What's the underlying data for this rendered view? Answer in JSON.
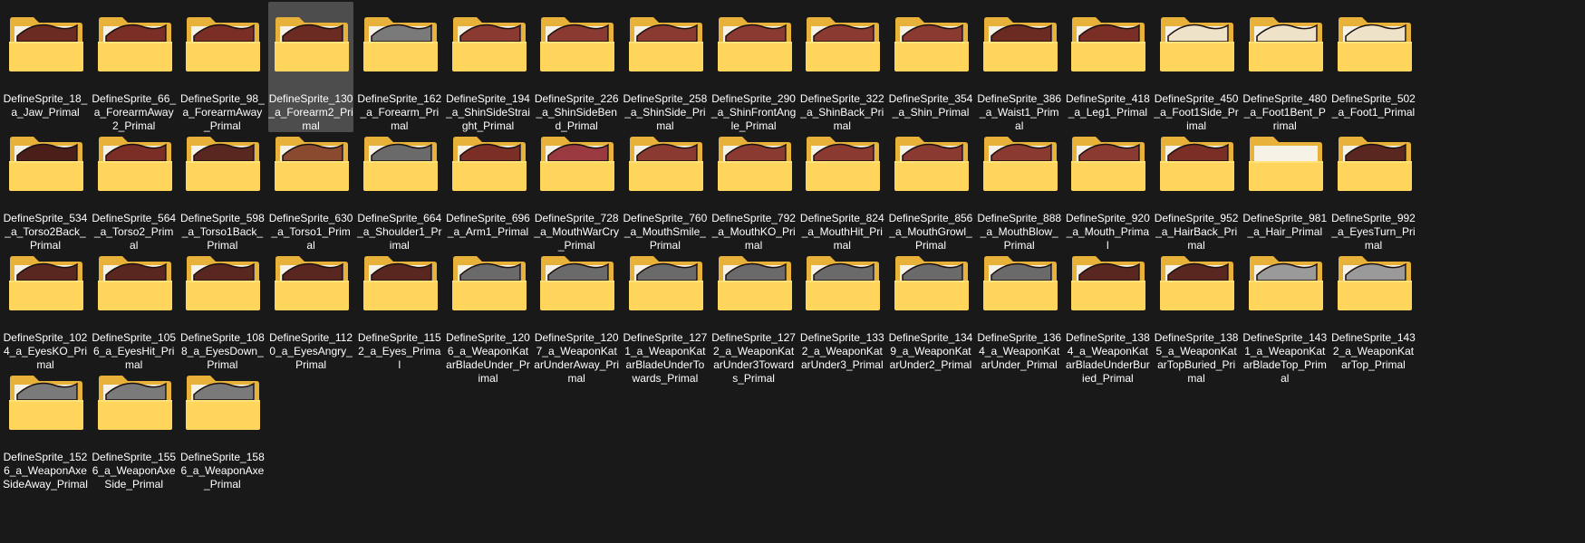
{
  "colors": {
    "background": "#191919",
    "selected": "#4d4d4d",
    "text": "#ffffff",
    "folder_back": "#e8b23a",
    "folder_front": "#ffd55c"
  },
  "icon_name": "folder-icon",
  "selected_index": 3,
  "items": [
    {
      "label": "DefineSprite_18_a_Jaw_Primal",
      "art": "#6b2a22"
    },
    {
      "label": "DefineSprite_66_a_ForearmAway2_Primal",
      "art": "#7a2e26"
    },
    {
      "label": "DefineSprite_98_a_ForearmAway_Primal",
      "art": "#7a2e26"
    },
    {
      "label": "DefineSprite_130_a_Forearm2_Primal",
      "art": "#6b2a22"
    },
    {
      "label": "DefineSprite_162_a_Forearm_Primal",
      "art": "#7a7a7a"
    },
    {
      "label": "DefineSprite_194_a_ShinSideStraight_Primal",
      "art": "#8a3a30"
    },
    {
      "label": "DefineSprite_226_a_ShinSideBend_Primal",
      "art": "#8a3a30"
    },
    {
      "label": "DefineSprite_258_a_ShinSide_Primal",
      "art": "#8a3a30"
    },
    {
      "label": "DefineSprite_290_a_ShinFrontAngle_Primal",
      "art": "#8a3a30"
    },
    {
      "label": "DefineSprite_322_a_ShinBack_Primal",
      "art": "#8a3a30"
    },
    {
      "label": "DefineSprite_354_a_Shin_Primal",
      "art": "#8a3a30"
    },
    {
      "label": "DefineSprite_386_a_Waist1_Primal",
      "art": "#6b2a22"
    },
    {
      "label": "DefineSprite_418_a_Leg1_Primal",
      "art": "#7a2e26"
    },
    {
      "label": "DefineSprite_450_a_Foot1Side_Primal",
      "art": "#eee3c8"
    },
    {
      "label": "DefineSprite_480_a_Foot1Bent_Primal",
      "art": "#eee3c8"
    },
    {
      "label": "DefineSprite_502_a_Foot1_Primal",
      "art": "#eee3c8"
    },
    {
      "label": "DefineSprite_534_a_Torso2Back_Primal",
      "art": "#4a1f1a"
    },
    {
      "label": "DefineSprite_564_a_Torso2_Primal",
      "art": "#7a2e26"
    },
    {
      "label": "DefineSprite_598_a_Torso1Back_Primal",
      "art": "#5a2720"
    },
    {
      "label": "DefineSprite_630_a_Torso1_Primal",
      "art": "#8a4a30"
    },
    {
      "label": "DefineSprite_664_a_Shoulder1_Primal",
      "art": "#6a6a6a"
    },
    {
      "label": "DefineSprite_696_a_Arm1_Primal",
      "art": "#7a2e26"
    },
    {
      "label": "DefineSprite_728_a_MouthWarCry_Primal",
      "art": "#9a3a40"
    },
    {
      "label": "DefineSprite_760_a_MouthSmile_Primal",
      "art": "#8a3a30"
    },
    {
      "label": "DefineSprite_792_a_MouthKO_Primal",
      "art": "#8a3a30"
    },
    {
      "label": "DefineSprite_824_a_MouthHit_Primal",
      "art": "#8a3a30"
    },
    {
      "label": "DefineSprite_856_a_MouthGrowl_Primal",
      "art": "#8a3a30"
    },
    {
      "label": "DefineSprite_888_a_MouthBlow_Primal",
      "art": "#8a3a30"
    },
    {
      "label": "DefineSprite_920_a_Mouth_Primal",
      "art": "#8a3a30"
    },
    {
      "label": "DefineSprite_952_a_HairBack_Primal",
      "art": "#7a2e26"
    },
    {
      "label": "DefineSprite_981_a_Hair_Primal",
      "art": ""
    },
    {
      "label": "DefineSprite_992_a_EyesTurn_Primal",
      "art": "#5a2720"
    },
    {
      "label": "DefineSprite_1024_a_EyesKO_Primal",
      "art": "#5a2720"
    },
    {
      "label": "DefineSprite_1056_a_EyesHit_Primal",
      "art": "#5a2720"
    },
    {
      "label": "DefineSprite_1088_a_EyesDown_Primal",
      "art": "#5a2720"
    },
    {
      "label": "DefineSprite_1120_a_EyesAngry_Primal",
      "art": "#5a2720"
    },
    {
      "label": "DefineSprite_1152_a_Eyes_Primal",
      "art": "#5a2720"
    },
    {
      "label": "DefineSprite_1206_a_WeaponKatarBladeUnder_Primal",
      "art": "#6a6a6a"
    },
    {
      "label": "DefineSprite_1207_a_WeaponKatarUnderAway_Primal",
      "art": "#6a6a6a"
    },
    {
      "label": "DefineSprite_1271_a_WeaponKatarBladeUnderTowards_Primal",
      "art": "#6a6a6a"
    },
    {
      "label": "DefineSprite_1272_a_WeaponKatarUnder3Towards_Primal",
      "art": "#6a6a6a"
    },
    {
      "label": "DefineSprite_1332_a_WeaponKatarUnder3_Primal",
      "art": "#6a6a6a"
    },
    {
      "label": "DefineSprite_1349_a_WeaponKatarUnder2_Primal",
      "art": "#6a6a6a"
    },
    {
      "label": "DefineSprite_1364_a_WeaponKatarUnder_Primal",
      "art": "#6a6a6a"
    },
    {
      "label": "DefineSprite_1384_a_WeaponKatarBladeUnderBuried_Primal",
      "art": "#5a2720"
    },
    {
      "label": "DefineSprite_1385_a_WeaponKatarTopBuried_Primal",
      "art": "#5a2720"
    },
    {
      "label": "DefineSprite_1431_a_WeaponKatarBladeTop_Primal",
      "art": "#9a9a9a"
    },
    {
      "label": "DefineSprite_1432_a_WeaponKatarTop_Primal",
      "art": "#9a9a9a"
    },
    {
      "label": "DefineSprite_1526_a_WeaponAxeSideAway_Primal",
      "art": "#7a7a7a"
    },
    {
      "label": "DefineSprite_1556_a_WeaponAxeSide_Primal",
      "art": "#7a7a7a"
    },
    {
      "label": "DefineSprite_1586_a_WeaponAxe_Primal",
      "art": "#7a7a7a"
    }
  ]
}
